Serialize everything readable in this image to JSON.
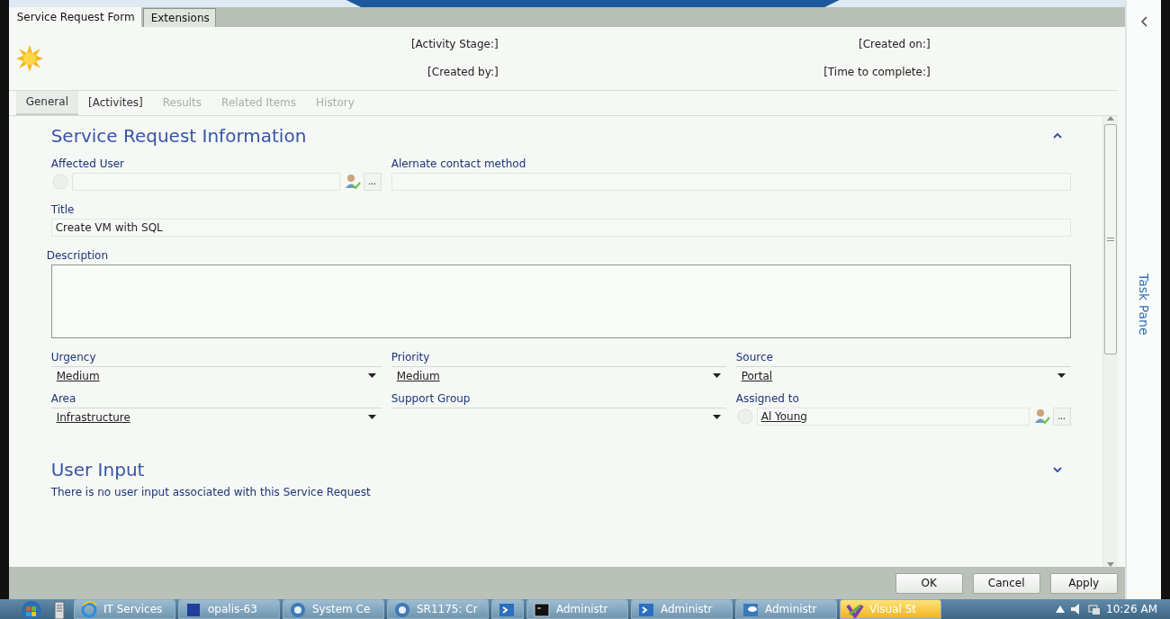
{
  "window_tabs": [
    {
      "label": "Service Request Form",
      "selected": true
    },
    {
      "label": "Extensions",
      "selected": false
    }
  ],
  "header": {
    "fields": [
      "[Activity Stage:]",
      "[Created on:]",
      "[Created by:]",
      "[Time to complete:]"
    ]
  },
  "tabs": [
    {
      "label": "General",
      "selected": true,
      "disabled": false
    },
    {
      "label": "[Activites]",
      "selected": false,
      "disabled": false
    },
    {
      "label": "Results",
      "selected": false,
      "disabled": true
    },
    {
      "label": "Related Items",
      "selected": false,
      "disabled": true
    },
    {
      "label": "History",
      "selected": false,
      "disabled": true
    }
  ],
  "sections": [
    {
      "title": "Service Request Information",
      "expanded": true,
      "rows": [
        [
          {
            "kind": "user",
            "label": "Affected User",
            "button": "..."
          },
          {
            "kind": "text",
            "label": "Alernate contact method"
          }
        ],
        [
          {
            "kind": "text",
            "label": "Title",
            "value": "Create VM with SQL"
          }
        ],
        [
          {
            "kind": "textarea",
            "label": "Description"
          }
        ],
        [
          {
            "kind": "dropdown",
            "label": "Urgency",
            "value": "Medium"
          },
          {
            "kind": "dropdown",
            "label": "Priority",
            "value": "Medium"
          },
          {
            "kind": "dropdown",
            "label": "Source",
            "value": "Portal"
          }
        ],
        [
          {
            "kind": "dropdown",
            "label": "Area",
            "value": "Infrastructure"
          },
          {
            "kind": "dropdown",
            "label": "Support Group"
          },
          {
            "kind": "user",
            "label": "Assigned to",
            "value": "Al Young",
            "button": "..."
          }
        ]
      ]
    },
    {
      "title": "User Input",
      "expanded": false,
      "note": "There is no user input associated with this Service Request"
    }
  ],
  "buttons": [
    "OK",
    "Cancel",
    "Apply"
  ],
  "task_pane": {
    "label": "Task Pane"
  },
  "taskbar": {
    "items": [
      {
        "label": "IT Services",
        "selected": false
      },
      {
        "label": "opalis-63",
        "selected": false
      },
      {
        "label": "System Ce",
        "selected": false
      },
      {
        "label": "SR1175: Cr",
        "selected": false
      },
      {
        "selected": false
      },
      {
        "label": "Administr",
        "selected": false
      },
      {
        "label": "Administr",
        "selected": false
      },
      {
        "label": "Administr",
        "selected": false
      },
      {
        "label": "Visual St",
        "selected": true
      }
    ],
    "clock": "10:26 AM"
  }
}
